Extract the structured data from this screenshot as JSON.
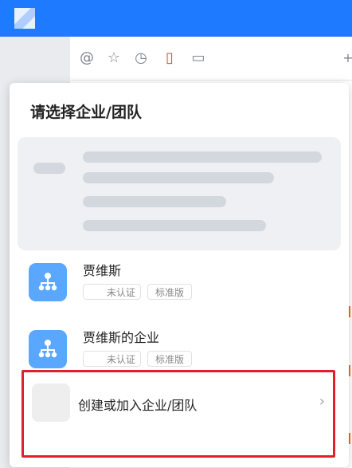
{
  "panel": {
    "title": "请选择企业/团队",
    "orgs": [
      {
        "name": "贾维斯",
        "tags": [
          "未认证",
          "标准版"
        ]
      },
      {
        "name": "贾维斯的企业",
        "tags": [
          "未认证",
          "标准版"
        ]
      }
    ],
    "create": {
      "label": "创建或加入企业/团队",
      "chevron": "›"
    }
  },
  "toolbar": {
    "icons": [
      "at-icon",
      "star-icon",
      "clock-icon",
      "document-red-icon",
      "file-icon"
    ]
  },
  "colors": {
    "topbar": "#1e7bff",
    "org_icon": "#5aa7ff",
    "highlight": "#e0202a"
  }
}
